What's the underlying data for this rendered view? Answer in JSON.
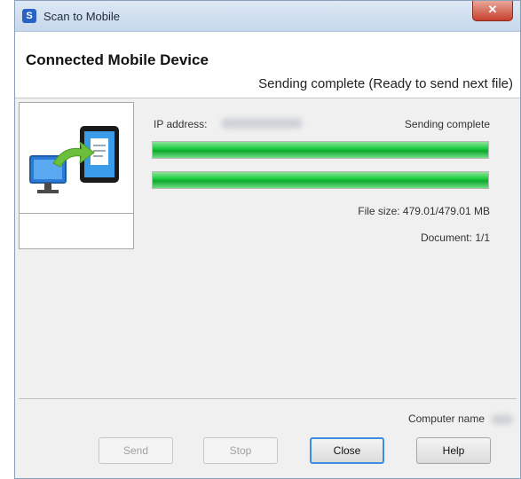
{
  "window": {
    "title": "Scan to Mobile",
    "close_glyph": "✕",
    "app_icon_glyph": "S"
  },
  "header": {
    "title": "Connected Mobile Device",
    "status": "Sending complete (Ready to send next file)"
  },
  "device": {
    "icon": "computer-to-tablet-icon"
  },
  "transfer": {
    "ip_label": "IP address:",
    "state": "Sending complete",
    "progress_1": 1.0,
    "progress_2": 1.0,
    "file_size": "File size: 479.01/479.01 MB",
    "document": "Document: 1/1"
  },
  "footer": {
    "computer_name_label": "Computer name"
  },
  "buttons": {
    "send": "Send",
    "stop": "Stop",
    "close": "Close",
    "help": "Help"
  },
  "colors": {
    "progress": "#14c93a",
    "default_button_border": "#3d8ee0",
    "close_button": "#c7402d"
  }
}
